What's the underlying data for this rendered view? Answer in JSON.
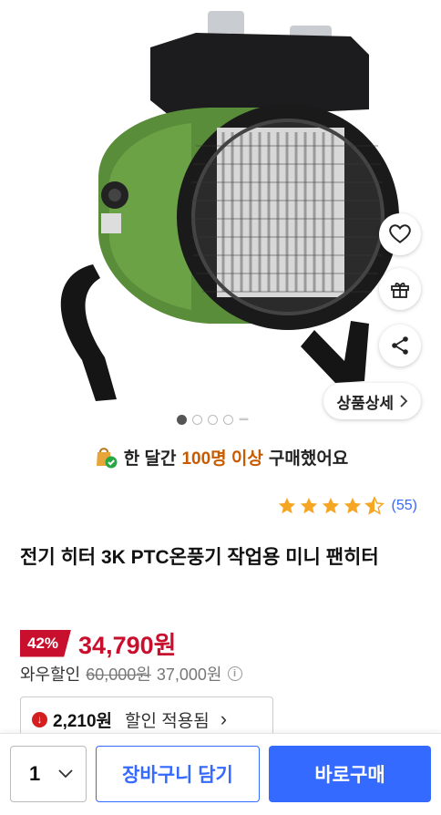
{
  "gallery": {
    "detail_label": "상품상세",
    "current_index": 1,
    "total_dots": 4,
    "more_indicator": "ᆖ"
  },
  "purchase_banner": {
    "prefix": "한 달간",
    "highlight": "100명 이상",
    "suffix": "구매했어요"
  },
  "rating": {
    "stars": 4.5,
    "count_text": "(55)"
  },
  "product": {
    "title": "전기 히터 3K PTC온풍기 작업용 미니 팬히터"
  },
  "price": {
    "discount": "42%",
    "sale": "34,790원",
    "wow_label": "와우할인",
    "original": "60,000원",
    "wow_price": "37,000원",
    "info_icon": "i"
  },
  "coupon": {
    "amount": "2,210원",
    "label": "할인 적용됨",
    "chevron": "›"
  },
  "bottom_bar": {
    "quantity": "1",
    "cart_label": "장바구니 담기",
    "buy_label": "바로구매"
  },
  "colors": {
    "accent": "#346aff",
    "sale_red": "#c8102e",
    "banner_highlight": "#c85a00",
    "star": "#f5a623"
  },
  "icons": [
    "heart-icon",
    "gift-icon",
    "share-icon",
    "chevron-right-icon",
    "chevron-down-icon",
    "star-icon",
    "shopping-bag-check-icon",
    "down-arrow-circle-icon",
    "info-icon"
  ]
}
